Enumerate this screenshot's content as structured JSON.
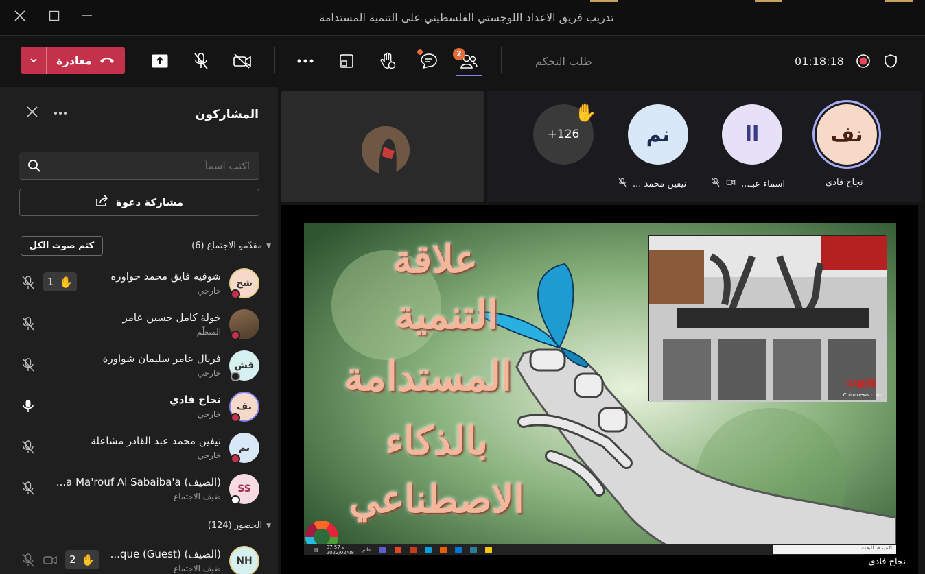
{
  "window": {
    "title": "تدريب فريق الاعداد اللوجستي الفلسطيني على التنمية المستدامة",
    "minimize_icon": "minimize-icon",
    "maximize_icon": "maximize-icon",
    "close_icon": "close-icon"
  },
  "toolbar": {
    "leave_label": "مغادرة",
    "control_label": "طلب التحكم",
    "timer": "01:18:18",
    "participants_badge": "2",
    "colors": {
      "leave": "#c4314b",
      "accent": "#7f85f5",
      "badge": "#e36d3b",
      "record": "#e74856"
    }
  },
  "sidebar": {
    "title": "المشاركون",
    "search_placeholder": "اكتب اسماً",
    "share_label": "مشاركة دعوة",
    "mute_all_label": "كتم صوت الكل",
    "presenters_header": "مقدّمو الاجتماع (6)",
    "attendees_header": "الحضور (124)",
    "participants": [
      {
        "initials": "شح",
        "name": "شوقيه فايق محمد حواوره",
        "role": "خارجي",
        "hand_count": "1",
        "status": "busy"
      },
      {
        "initials": "",
        "name": "خولة كامل حسين عامر",
        "role": "المنظّم",
        "status": "busy"
      },
      {
        "initials": "فش",
        "name": "فريال عامر سليمان شواورة",
        "role": "خارجي",
        "status": "offline"
      },
      {
        "initials": "نف",
        "name": "نجاح فادي",
        "role": "خارجي",
        "status": "dnd"
      },
      {
        "initials": "نم",
        "name": "نيفين محمد عبد القادر مشاعلة",
        "role": "خارجي",
        "status": "busy"
      },
      {
        "initials": "SS",
        "name": "(الضيف) a Ma'rouf Al Sabaiba'a...",
        "role": "ضيف الاجتماع",
        "status": "unknown"
      },
      {
        "initials": "NH",
        "name": "(الضيف) que (Guest)...",
        "role": "ضيف الاجتماع",
        "hand_count": "2",
        "status": "unknown"
      }
    ]
  },
  "gallery": {
    "overflow_count": "+126",
    "tiles": [
      {
        "initials": "نف",
        "label": "نجاح فادي"
      },
      {
        "initials": "اا",
        "label": "اسماء عبـ..."
      },
      {
        "initials": "نم",
        "label": "نيفين محمد ..."
      }
    ]
  },
  "presentation": {
    "slide_lines": [
      "علاقة",
      "التنمية",
      "المستدامة",
      "بالذكاء",
      "الاصطناعي"
    ],
    "watermark": "中新网",
    "watermark_sub": "Chinanews.com",
    "taskbar_time": "07:57 م",
    "taskbar_date": "2022/02/08",
    "taskbar_lang": "عالم",
    "taskbar_search": "اكتب هنا للبحث",
    "presenter_name": "نجاح فادي"
  }
}
